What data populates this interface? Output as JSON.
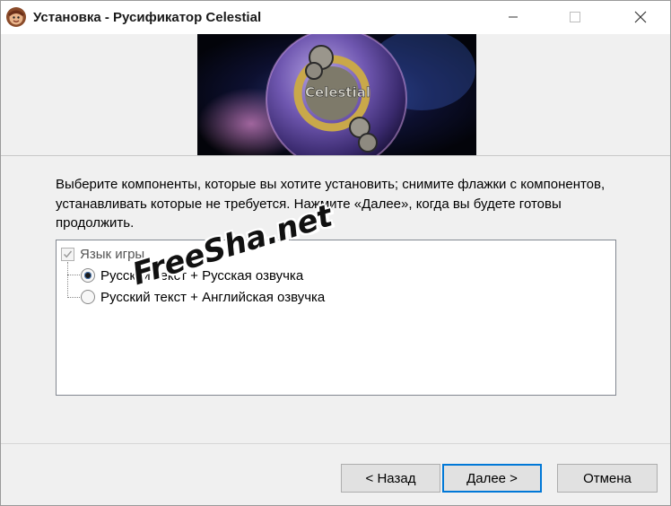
{
  "window": {
    "title": "Установка - Русификатор Celestial",
    "app_icon": "installer-app-icon",
    "controls": [
      "minimize-icon",
      "maximize-icon",
      "close-icon"
    ]
  },
  "banner": {
    "logo_text": "Celestial"
  },
  "description": "Выберите компоненты, которые вы хотите установить; снимите флажки с компонентов, устанавливать которые не требуется. Нажмите «Далее», когда вы будете готовы продолжить.",
  "components": {
    "root": {
      "label": "Язык игры",
      "checked": true,
      "disabled": true
    },
    "options": [
      {
        "label": "Русский текст + Русская озвучка",
        "selected": true
      },
      {
        "label": "Русский текст + Английская озвучка",
        "selected": false
      }
    ]
  },
  "watermark": "FreeSha.net",
  "buttons": {
    "back": "< Назад",
    "next": "Далее >",
    "cancel": "Отмена"
  },
  "colors": {
    "focus_border": "#0078d7",
    "window_bg": "#f0f0f0"
  }
}
